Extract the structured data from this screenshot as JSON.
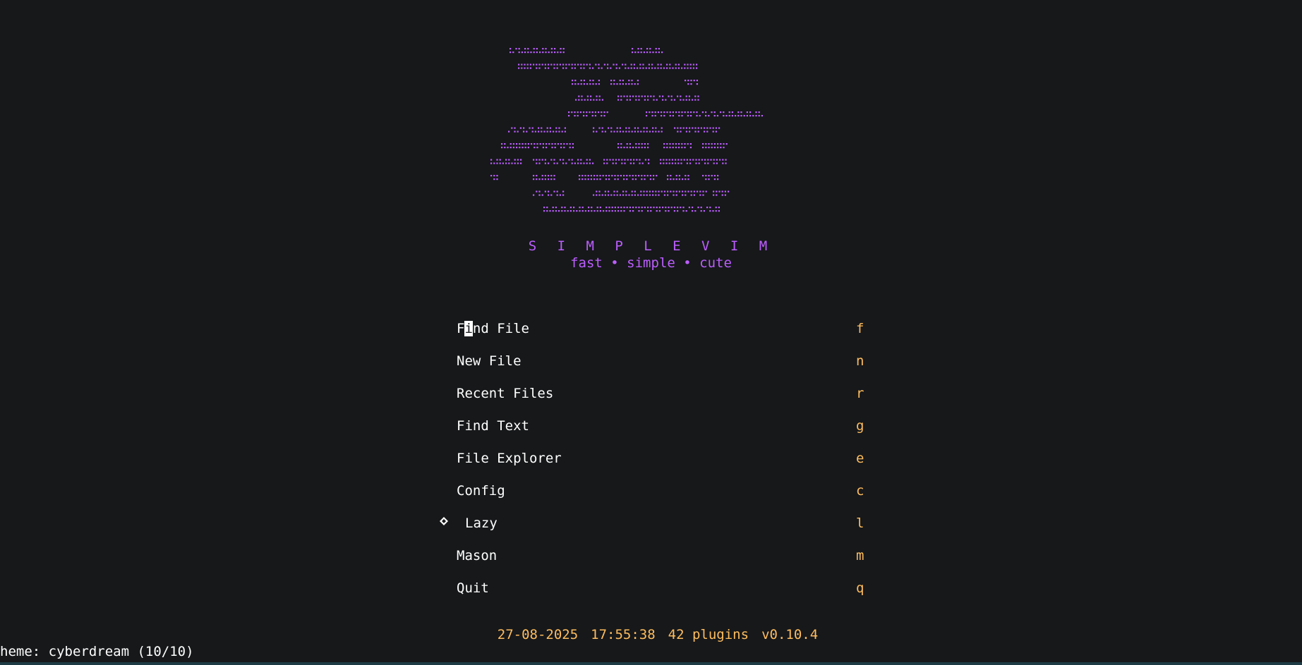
{
  "dashboard": {
    "title": "S I M P L E V I M",
    "tagline": "fast • simple • cute",
    "logo_color": "#bd5eff"
  },
  "menu": {
    "items": [
      {
        "label": "Find File",
        "key": "f"
      },
      {
        "label": "New File",
        "key": "n"
      },
      {
        "label": "Recent Files",
        "key": "r"
      },
      {
        "label": "Find Text",
        "key": "g"
      },
      {
        "label": "File Explorer",
        "key": "e"
      },
      {
        "label": "Config",
        "key": "c"
      },
      {
        "label": "Lazy",
        "key": "l",
        "icon": "lazy-icon"
      },
      {
        "label": "Mason",
        "key": "m"
      },
      {
        "label": "Quit",
        "key": "q"
      }
    ],
    "find_file_parts": {
      "before": "F",
      "cursor": "i",
      "after": "nd File"
    }
  },
  "footer": {
    "date": "27-08-2025",
    "time": "17:55:38",
    "plugins": "42 plugins",
    "version": "v0.10.4"
  },
  "cmdline": {
    "text": "heme: cyberdream (10/10)"
  },
  "colors": {
    "background": "#16181a",
    "accent_purple": "#bd5eff",
    "key_orange": "#ffbd5e",
    "text": "#ffffff"
  }
}
